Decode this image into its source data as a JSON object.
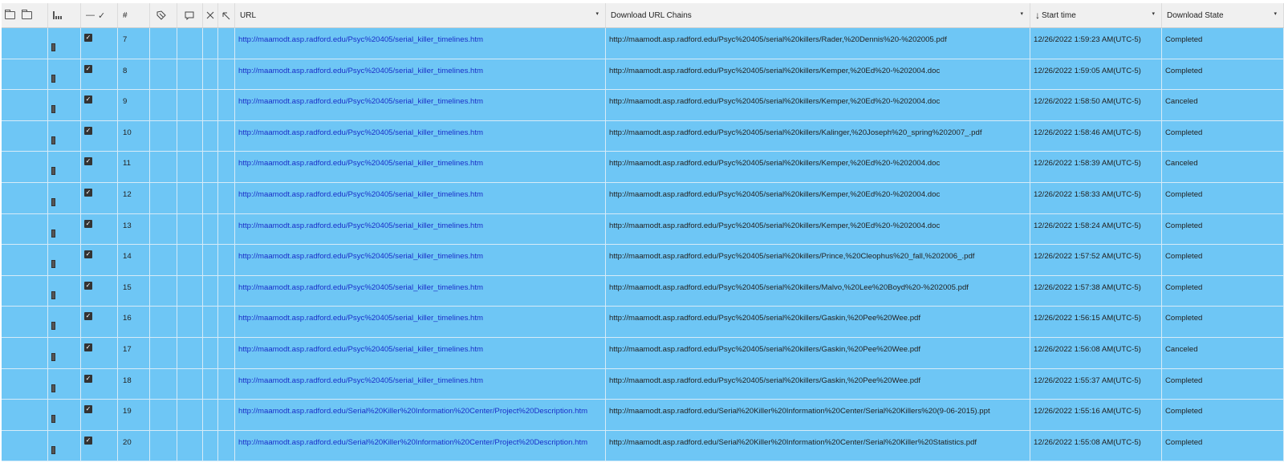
{
  "header": {
    "open_folder_icon": "folder-open-icon",
    "folder_icon": "folder-icon",
    "bars_icon": "bar-chart-icon",
    "dash_label": "—",
    "check_label": "✓",
    "hash_label": "#",
    "tag_icon": "tag-icon",
    "comment_icon": "comment-icon",
    "close_icon": "close-icon",
    "arrow_icon": "arrow-up-left-icon",
    "url_label": "URL",
    "chains_label": "Download URL Chains",
    "start_label": "Start time",
    "sort_icon": "↓",
    "state_label": "Download State",
    "dropdown_glyph": "▾"
  },
  "rows": [
    {
      "num": "7",
      "url": "http://maamodt.asp.radford.edu/Psyc%20405/serial_killer_timelines.htm",
      "chain": "http://maamodt.asp.radford.edu/Psyc%20405/serial%20killers/Rader,%20Dennis%20-%202005.pdf",
      "time": "12/26/2022 1:59:23 AM(UTC-5)",
      "state": "Completed"
    },
    {
      "num": "8",
      "url": "http://maamodt.asp.radford.edu/Psyc%20405/serial_killer_timelines.htm",
      "chain": "http://maamodt.asp.radford.edu/Psyc%20405/serial%20killers/Kemper,%20Ed%20-%202004.doc",
      "time": "12/26/2022 1:59:05 AM(UTC-5)",
      "state": "Completed"
    },
    {
      "num": "9",
      "url": "http://maamodt.asp.radford.edu/Psyc%20405/serial_killer_timelines.htm",
      "chain": "http://maamodt.asp.radford.edu/Psyc%20405/serial%20killers/Kemper,%20Ed%20-%202004.doc",
      "time": "12/26/2022 1:58:50 AM(UTC-5)",
      "state": "Canceled"
    },
    {
      "num": "10",
      "url": "http://maamodt.asp.radford.edu/Psyc%20405/serial_killer_timelines.htm",
      "chain": "http://maamodt.asp.radford.edu/Psyc%20405/serial%20killers/Kalinger,%20Joseph%20_spring%202007_.pdf",
      "time": "12/26/2022 1:58:46 AM(UTC-5)",
      "state": "Completed"
    },
    {
      "num": "11",
      "url": "http://maamodt.asp.radford.edu/Psyc%20405/serial_killer_timelines.htm",
      "chain": "http://maamodt.asp.radford.edu/Psyc%20405/serial%20killers/Kemper,%20Ed%20-%202004.doc",
      "time": "12/26/2022 1:58:39 AM(UTC-5)",
      "state": "Canceled"
    },
    {
      "num": "12",
      "url": "http://maamodt.asp.radford.edu/Psyc%20405/serial_killer_timelines.htm",
      "chain": "http://maamodt.asp.radford.edu/Psyc%20405/serial%20killers/Kemper,%20Ed%20-%202004.doc",
      "time": "12/26/2022 1:58:33 AM(UTC-5)",
      "state": "Completed"
    },
    {
      "num": "13",
      "url": "http://maamodt.asp.radford.edu/Psyc%20405/serial_killer_timelines.htm",
      "chain": "http://maamodt.asp.radford.edu/Psyc%20405/serial%20killers/Kemper,%20Ed%20-%202004.doc",
      "time": "12/26/2022 1:58:24 AM(UTC-5)",
      "state": "Completed"
    },
    {
      "num": "14",
      "url": "http://maamodt.asp.radford.edu/Psyc%20405/serial_killer_timelines.htm",
      "chain": "http://maamodt.asp.radford.edu/Psyc%20405/serial%20killers/Prince,%20Cleophus%20_fall,%202006_.pdf",
      "time": "12/26/2022 1:57:52 AM(UTC-5)",
      "state": "Completed"
    },
    {
      "num": "15",
      "url": "http://maamodt.asp.radford.edu/Psyc%20405/serial_killer_timelines.htm",
      "chain": "http://maamodt.asp.radford.edu/Psyc%20405/serial%20killers/Malvo,%20Lee%20Boyd%20-%202005.pdf",
      "time": "12/26/2022 1:57:38 AM(UTC-5)",
      "state": "Completed"
    },
    {
      "num": "16",
      "url": "http://maamodt.asp.radford.edu/Psyc%20405/serial_killer_timelines.htm",
      "chain": "http://maamodt.asp.radford.edu/Psyc%20405/serial%20killers/Gaskin,%20Pee%20Wee.pdf",
      "time": "12/26/2022 1:56:15 AM(UTC-5)",
      "state": "Completed"
    },
    {
      "num": "17",
      "url": "http://maamodt.asp.radford.edu/Psyc%20405/serial_killer_timelines.htm",
      "chain": "http://maamodt.asp.radford.edu/Psyc%20405/serial%20killers/Gaskin,%20Pee%20Wee.pdf",
      "time": "12/26/2022 1:56:08 AM(UTC-5)",
      "state": "Canceled"
    },
    {
      "num": "18",
      "url": "http://maamodt.asp.radford.edu/Psyc%20405/serial_killer_timelines.htm",
      "chain": "http://maamodt.asp.radford.edu/Psyc%20405/serial%20killers/Gaskin,%20Pee%20Wee.pdf",
      "time": "12/26/2022 1:55:37 AM(UTC-5)",
      "state": "Completed"
    },
    {
      "num": "19",
      "url": "http://maamodt.asp.radford.edu/Serial%20Killer%20Information%20Center/Project%20Description.htm",
      "chain": "http://maamodt.asp.radford.edu/Serial%20Killer%20Information%20Center/Serial%20Killers%20(9-06-2015).ppt",
      "time": "12/26/2022 1:55:16 AM(UTC-5)",
      "state": "Completed"
    },
    {
      "num": "20",
      "url": "http://maamodt.asp.radford.edu/Serial%20Killer%20Information%20Center/Project%20Description.htm",
      "chain": "http://maamodt.asp.radford.edu/Serial%20Killer%20Information%20Center/Serial%20Killer%20Statistics.pdf",
      "time": "12/26/2022 1:55:08 AM(UTC-5)",
      "state": "Completed"
    }
  ],
  "colors": {
    "row_bg": "#6ec6f5",
    "link": "#1a2ec8"
  }
}
